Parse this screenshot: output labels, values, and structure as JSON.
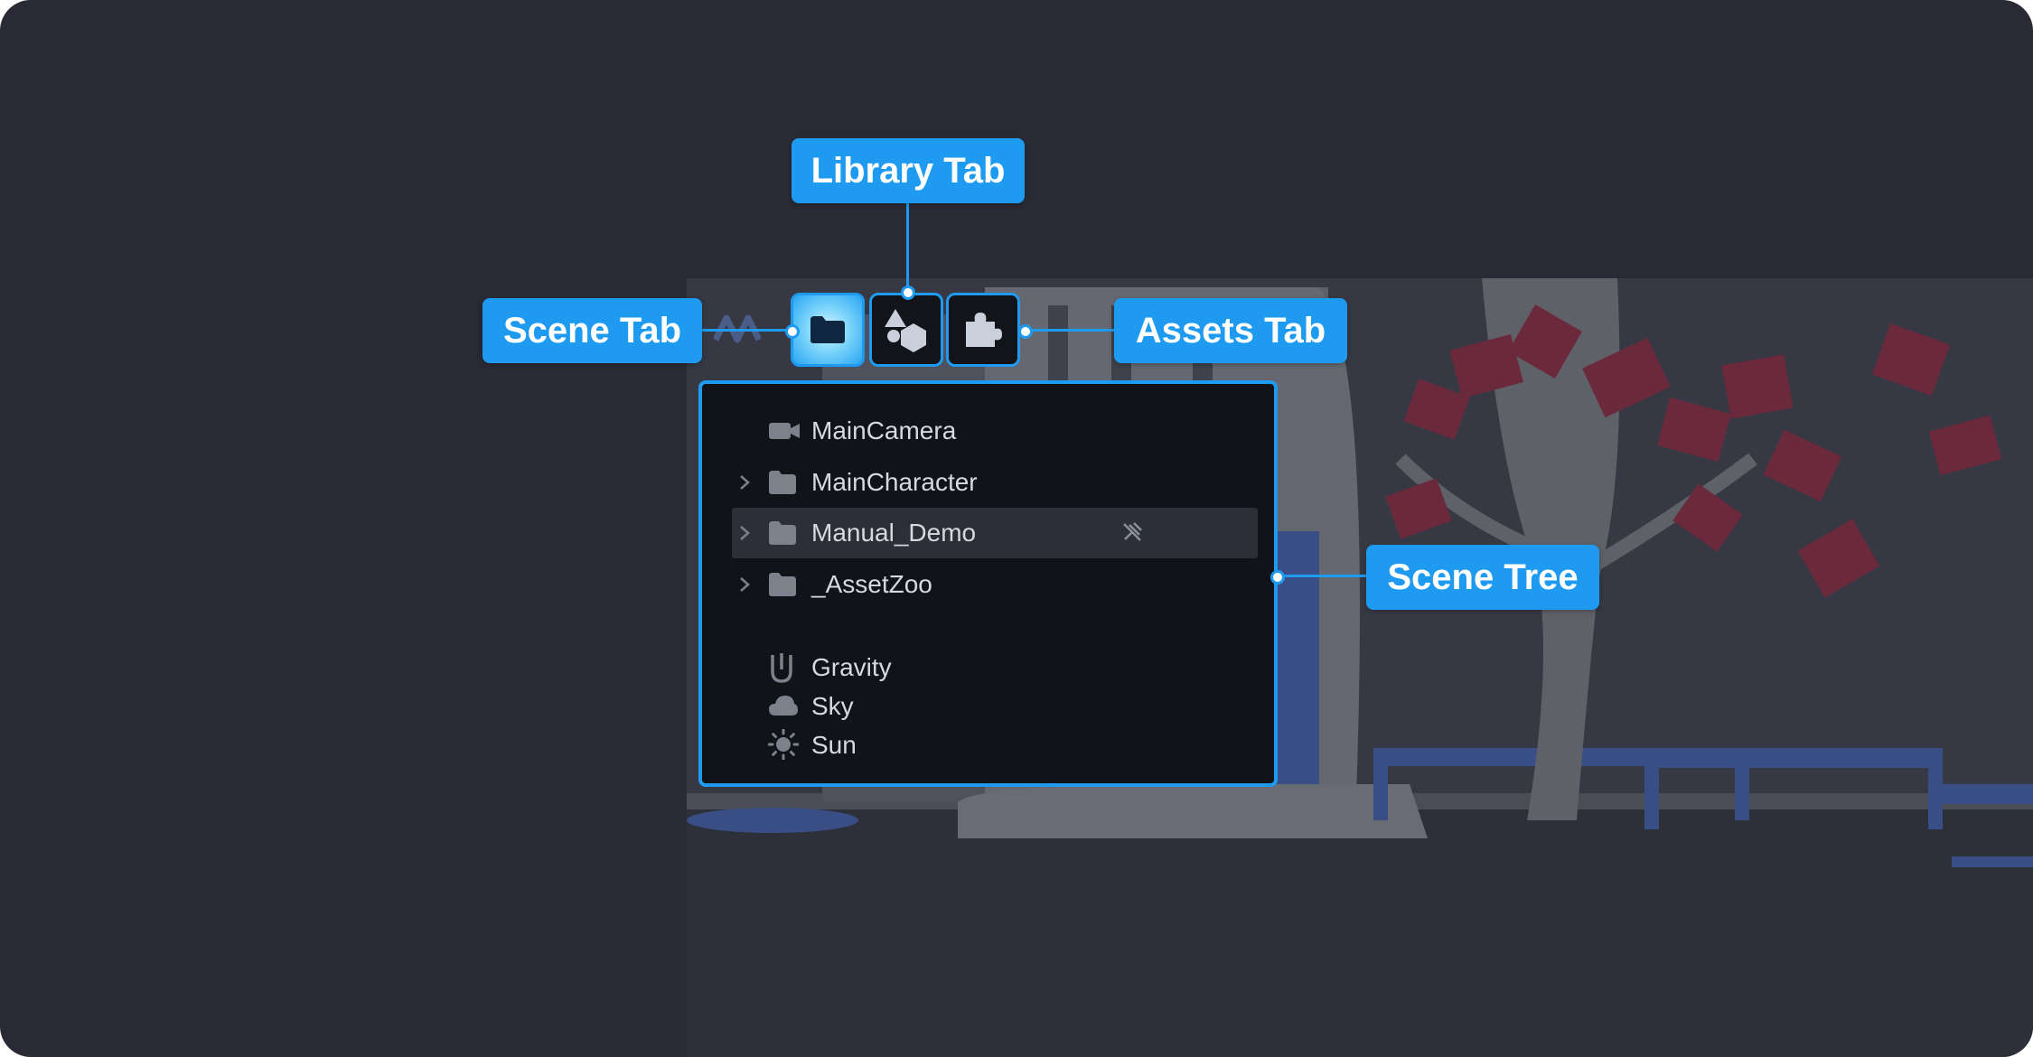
{
  "callouts": {
    "library_tab": "Library Tab",
    "scene_tab": "Scene Tab",
    "assets_tab": "Assets Tab",
    "scene_tree": "Scene Tree"
  },
  "tabs": [
    {
      "id": "scene",
      "icon": "folder-icon",
      "active": true
    },
    {
      "id": "library",
      "icon": "shapes-icon",
      "active": false
    },
    {
      "id": "assets",
      "icon": "puzzle-icon",
      "active": false
    }
  ],
  "scene_tree": {
    "items": [
      {
        "label": "MainCamera",
        "icon": "camera-icon",
        "expandable": false
      },
      {
        "label": "MainCharacter",
        "icon": "folder-icon",
        "expandable": true
      },
      {
        "label": "Manual_Demo",
        "icon": "folder-icon",
        "expandable": true,
        "selected": true
      },
      {
        "label": "_AssetZoo",
        "icon": "folder-icon",
        "expandable": true
      }
    ],
    "environment": [
      {
        "label": "Gravity",
        "icon": "gravity-icon"
      },
      {
        "label": "Sky",
        "icon": "cloud-icon"
      },
      {
        "label": "Sun",
        "icon": "sun-icon"
      }
    ]
  },
  "colors": {
    "accent": "#1e9bf0",
    "background": "#2a2a36",
    "panel": "#101318"
  }
}
